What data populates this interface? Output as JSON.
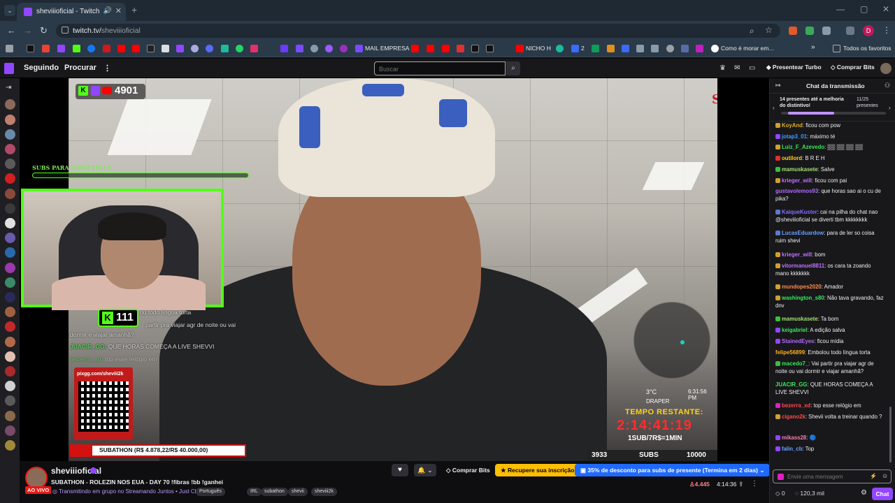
{
  "browser": {
    "tab_title": "sheviiioficial - Twitch",
    "url_host": "twitch.tv/",
    "url_path": "sheviiioficial",
    "profile_letter": "D"
  },
  "bookmarks": {
    "mail_empresa": "MAIL EMPRESA",
    "nicho": "NICHO H",
    "two": "2",
    "como_morar": "Como é morar em...",
    "todos_favoritos": "Todos os favoritos"
  },
  "twitch_nav": {
    "following": "Seguindo",
    "browse": "Procurar",
    "search_placeholder": "Buscar",
    "turbo": "Presentear Turbo",
    "buy_bits": "Comprar Bits"
  },
  "overlay": {
    "counter": "4901",
    "subs_label": "SUBS PARA MONETIZAR",
    "kick_count": "111",
    "chat_lines": [
      {
        "user": "",
        "text": "ou todo língua torta"
      },
      {
        "user": "",
        "text": "partir pra viajar agr de noite ou vai"
      },
      {
        "user": "",
        "text": "dormir e viajar amanhã?"
      },
      {
        "user": "JUACIR_GG:",
        "text": "QUE HORAS COMEÇA A LIVE SHEVVI"
      },
      {
        "user": "bezerra_xd:",
        "text": "top esse relógio em"
      }
    ],
    "qr_url": "pixgg.com/sheviii2k",
    "subathon": "SUBATHON (R$ 4.878,22/R$ 40.000,00)",
    "hud_temp": "3°C",
    "hud_time": "6:31:56 PM",
    "hud_city": "DRAPER",
    "tempo_restante": "TEMPO RESTANTE:",
    "clock": "2:14:41:19",
    "rule": "1SUB/7R$=1MIN",
    "subs_current": "3933",
    "subs_label2": "SUBS",
    "subs_goal": "10000"
  },
  "stream_info": {
    "live_badge": "AO VIVO",
    "channel": "sheviiioficial",
    "title": "SUBATHON - ROLEZIN NOS EUA - DAY 70 !fibras !bb !ganhei",
    "subline": "Transmitindo em grupo no Streamando Juntos • Just Chatting",
    "tags": [
      "Português",
      "IRL",
      "subathon",
      "shevii",
      "sheviii2k"
    ],
    "buy_bits": "Comprar Bits",
    "resub": "Recupere sua inscrição",
    "discount": "35% de desconto para subs de presente (Termina em 2 dias)",
    "viewers": "4.445",
    "uptime": "4:14:36"
  },
  "chat": {
    "header": "Chat da transmissão",
    "gift_text": "14 presentes até a melhoria do distintivo!",
    "gift_count": "11/25 presentes",
    "gift_progress": 0.44,
    "messages": [
      {
        "user": "KoyAnd",
        "color": "#e0b020",
        "badge": "#d0a030",
        "text": ": ficou com pow"
      },
      {
        "user": "jotap3_01",
        "color": "#3ea0ff",
        "badge": "#9146ff",
        "text": ": máximo té"
      },
      {
        "user": "Luiz_F_Azevedo",
        "color": "#3ae85a",
        "badge": "#d0a030",
        "text": ": ▒▒ ▒▒ ▒▒ ▒▒"
      },
      {
        "user": "outilord",
        "color": "#ffd21f",
        "badge": "#e03030",
        "text": ": B R E H"
      },
      {
        "user": "mamuskasete",
        "color": "#a0e070",
        "badge": "#3ac03a",
        "text": ": Salve"
      },
      {
        "user": "krieger_will",
        "color": "#c070ff",
        "badge": "#d0a030",
        "text": ": ficou com pai"
      },
      {
        "user": "gustavolemos93",
        "color": "#b06aff",
        "badge": "",
        "text": ": que horas sao ai o cu de pika?"
      },
      {
        "user": "KaiqueKuster",
        "color": "#8a6aff",
        "badge": "#5a7ad0",
        "text": ": cai na pilha do chat nao @sheviiioficial se diverti tbm kkkkkkkk"
      },
      {
        "user": "LucasEduardow",
        "color": "#6aa0ff",
        "badge": "#5a7ad0",
        "text": ": para de ler so coisa ruim shevi"
      },
      {
        "user": "krieger_will",
        "color": "#c070ff",
        "badge": "#d0a030",
        "text": ": bom"
      },
      {
        "user": "vitormanuel8811",
        "color": "#c070ff",
        "badge": "#d0a030",
        "text": ": os cara ta zoando mano kkkkkkk"
      },
      {
        "user": "mundopes2020",
        "color": "#ff8a4a",
        "badge": "#d0a030",
        "text": ": Amador"
      },
      {
        "user": "washington_s80",
        "color": "#3ae85a",
        "badge": "#d0a030",
        "text": ": Não tava gravando, faz dnv"
      },
      {
        "user": "mamuskasete",
        "color": "#a0e070",
        "badge": "#3ac03a",
        "text": ": Ta bom"
      },
      {
        "user": "keigabriel",
        "color": "#3ae85a",
        "badge": "#9146ff",
        "text": ": A edição salva"
      },
      {
        "user": "StainedEyes",
        "color": "#b06aff",
        "badge": "#9146ff",
        "text": ": ficou mídia"
      },
      {
        "user": "felipe56899",
        "color": "#ffb020",
        "badge": "",
        "text": ": Embolou todo língua torta"
      },
      {
        "user": "macedo7_",
        "color": "#3ae85a",
        "badge": "#3ac03a",
        "text": ": Vai partir pra viajar agr de noite ou vai dormir e viajar amanhã?"
      },
      {
        "user": "JUACIR_GG",
        "color": "#3ae85a",
        "badge": "",
        "text": ": QUE HORAS COMEÇA A LIVE SHEVVI"
      },
      {
        "user": "bezerra_xd",
        "color": "#ff4a4a",
        "badge": "#e020c0",
        "text": ": top esse relógio em"
      },
      {
        "user": "cigano2k",
        "color": "#ff4a4a",
        "badge": "#d0a030",
        "text": ": Shevii volta a treinar quando ?"
      },
      {
        "user": "mikass28",
        "color": "#ff7ab0",
        "badge": "#9146ff",
        "text": ": 🔵"
      },
      {
        "user": "falin_cb",
        "color": "#6aa0ff",
        "badge": "#9146ff",
        "text": ": Top"
      }
    ],
    "input_placeholder": "Envie uma mensagem",
    "points": "0",
    "channel_points": "120,3 mil",
    "send_button": "Chat"
  }
}
